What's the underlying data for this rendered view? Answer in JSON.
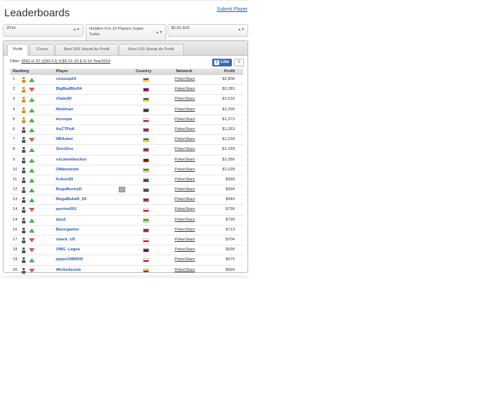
{
  "header": {
    "title": "Leaderboards",
    "submit_player": "Submit Player"
  },
  "filters": {
    "year": "2014",
    "game": "Holdem 9 to 10 Players Super Turbo",
    "stakes": "$5.01-$15"
  },
  "tabs": [
    {
      "label": "Profit",
      "active": true
    },
    {
      "label": "Count",
      "active": false
    },
    {
      "label": "Best 500 Streak Av Profit",
      "active": false
    },
    {
      "label": "Best 100 Streak Av Profit",
      "active": false
    }
  ],
  "filter_label": "Filter:",
  "filter_value": "SNG H ST ((DN FJ) S:$5.01-15 E:9-10 Year2014",
  "like": {
    "label": "Like",
    "count": "0"
  },
  "table": {
    "headers": {
      "ranking": "Ranking",
      "player": "Player",
      "country": "Country",
      "network": "Network",
      "profit": "Profit"
    },
    "rows": [
      {
        "rank": "1",
        "avatar": "gold",
        "trend": "up",
        "player": "closeup24",
        "flag": [
          "#1e5fb3",
          "#f5d000"
        ],
        "network": "PokerStars",
        "profit": "$2,806"
      },
      {
        "rank": "2",
        "avatar": "gold",
        "trend": "down",
        "player": "BigBadBluff4",
        "flag": [
          "#1d2a6b",
          "#c8102e"
        ],
        "network": "PokerStars",
        "profit": "$2,283"
      },
      {
        "rank": "3",
        "avatar": "gold",
        "trend": "up",
        "player": "Vladu90",
        "flag": [
          "#1e3fa0",
          "#f5d000"
        ],
        "network": "PokerStars",
        "profit": "$1,616"
      },
      {
        "rank": "4",
        "avatar": "gold",
        "trend": "up",
        "player": "Niedman",
        "flag": [
          "#c8102e",
          "#1d2a6b"
        ],
        "network": "PokerStars",
        "profit": "$1,290"
      },
      {
        "rank": "5",
        "avatar": "gold",
        "trend": "up",
        "player": "keronpa",
        "flag": [
          "#ffffff",
          "#d7001d"
        ],
        "network": "PokerStars",
        "profit": "$1,273"
      },
      {
        "rank": "6",
        "avatar": "grey",
        "trend": "up",
        "player": "AsCTPuK",
        "flag": [
          "#2a45b0",
          "#d52b1e"
        ],
        "network": "PokerStars",
        "profit": "$1,253"
      },
      {
        "rank": "7",
        "avatar": "grey",
        "trend": "down",
        "player": "NBAskel",
        "flag": [
          "#1e5fb3",
          "#f5d000"
        ],
        "network": "PokerStars",
        "profit": "$1,239"
      },
      {
        "rank": "8",
        "avatar": "grey",
        "trend": "up",
        "player": "OrexDno",
        "flag": [
          "#2a45b0",
          "#d52b1e"
        ],
        "network": "PokerStars",
        "profit": "$1,193"
      },
      {
        "rank": "9",
        "avatar": "grey",
        "trend": "up",
        "player": "xxLammbockxx",
        "flag": [
          "#222222",
          "#dd0000"
        ],
        "network": "PokerStars",
        "profit": "$1,056"
      },
      {
        "rank": "10",
        "avatar": "grey",
        "trend": "up",
        "player": "OManstrom",
        "flag": [
          "#3a6bb3",
          "#f5d000"
        ],
        "network": "PokerStars",
        "profit": "$1,028"
      },
      {
        "rank": "11",
        "avatar": "grey",
        "trend": "up",
        "player": "Kukoc69",
        "flag": [
          "#d52b1e",
          "#1e3fa0"
        ],
        "network": "PokerStars",
        "profit": "$999"
      },
      {
        "rank": "12",
        "avatar": "grey",
        "trend": "up",
        "player": "BugsBunnyD",
        "badge": true,
        "flag": [
          "#d52b1e",
          "#1e3fa0"
        ],
        "network": "PokerStars",
        "profit": "$994"
      },
      {
        "rank": "13",
        "avatar": "grey",
        "trend": "up",
        "player": "MegaBobeR_55",
        "flag": [
          "#2a45b0",
          "#d52b1e"
        ],
        "network": "PokerStars",
        "profit": "$940"
      },
      {
        "rank": "14",
        "avatar": "grey",
        "trend": "down",
        "player": "perrine501",
        "flag": [
          "#ffffff",
          "#d7001d"
        ],
        "network": "PokerStars",
        "profit": "$799"
      },
      {
        "rank": "14",
        "avatar": "grey",
        "trend": "up",
        "player": "duu2",
        "flag": [
          "#229e45",
          "#f5d000"
        ],
        "network": "PokerStars",
        "profit": "$799"
      },
      {
        "rank": "16",
        "avatar": "grey",
        "trend": "up",
        "player": "Basicgamer",
        "flag": [
          "#c8102e",
          "#3a6b3a"
        ],
        "network": "PokerStars",
        "profit": "$713"
      },
      {
        "rank": "17",
        "avatar": "grey",
        "trend": "down",
        "player": "istack_U5",
        "flag": [
          "#ffffff",
          "#d80621"
        ],
        "network": "PokerStars",
        "profit": "$704"
      },
      {
        "rank": "18",
        "avatar": "grey",
        "trend": "down",
        "player": "OMG_Legea",
        "flag": [
          "#c8102e",
          "#1d2a6b"
        ],
        "network": "PokerStars",
        "profit": "$699"
      },
      {
        "rank": "19",
        "avatar": "grey",
        "trend": "up",
        "player": "pippo1985930",
        "flag": [
          "#ffffff",
          "#d7001d"
        ],
        "network": "PokerStars",
        "profit": "$675"
      },
      {
        "rank": "20",
        "avatar": "grey",
        "trend": "down",
        "player": "Wickedsouls",
        "flag": [
          "#fdb913",
          "#006a44"
        ],
        "network": "PokerStars",
        "profit": "$669"
      }
    ]
  }
}
